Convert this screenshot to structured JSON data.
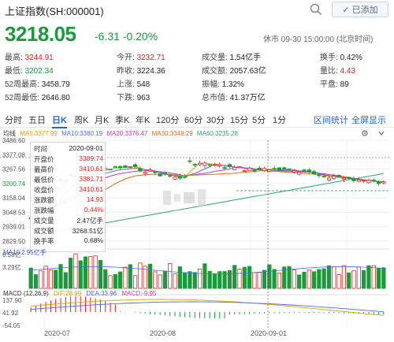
{
  "header": {
    "title": "上证指数(SH:000001)",
    "added_label": "已添加",
    "added_icon": "check-icon",
    "search_icon": "search-icon"
  },
  "quote": {
    "price": "3218.05",
    "change": "-6.31",
    "change_pct": "-0.20%",
    "status_time": "休市 09-30 15:00:00 (北京时间)"
  },
  "stats": {
    "high_label": "最高:",
    "high": "3244.91",
    "low_label": "最低:",
    "low": "3202.34",
    "wk52_high_label": "52周最高:",
    "wk52_high": "3458.79",
    "wk52_low_label": "52周最低:",
    "wk52_low": "2646.80",
    "open_label": "今开:",
    "open": "3232.71",
    "prev_close_label": "昨收:",
    "prev_close": "3224.36",
    "up_label": "上涨:",
    "up": "548",
    "down_label": "下跌:",
    "down": "963",
    "volume_label": "成交量:",
    "volume": "1.54亿手",
    "turnover_label": "成交额:",
    "turnover": "2057.63亿",
    "amplitude_label": "振幅:",
    "amplitude": "1.32%",
    "mktcap_label": "总市值:",
    "mktcap": "41.37万亿",
    "turnover_rate_label": "换手:",
    "turnover_rate": "0.42%",
    "vol_ratio_label": "量比:",
    "vol_ratio": "4.43",
    "flat_label": "平盘:",
    "flat": "89"
  },
  "tabs": [
    "分时",
    "五日",
    "日K",
    "周K",
    "月K",
    "季K",
    "年K",
    "120分",
    "60分",
    "30分",
    "15分",
    "5分",
    "1分"
  ],
  "active_tab": "日K",
  "tab_actions": {
    "interval_stats": "区间统计",
    "fullscreen": "全屏显示"
  },
  "ma_legend": {
    "ma_label": "均线",
    "ma5": "MA5:3377.99",
    "ma10": "MA10:3380.19",
    "ma20": "MA20:3376.47",
    "ma30": "MA30:3348.29",
    "ma60": "MA60:3235.28",
    "settings_icon": "gear-icon",
    "collapse_icon": "chevron-down-icon"
  },
  "colors": {
    "up": "#e02020",
    "down": "#1a9a3a",
    "ma5": "#d9a100",
    "ma10": "#4a6fd8",
    "ma20": "#c43bbd",
    "ma30": "#e06a1a",
    "ma60": "#2aa37a",
    "accent": "#2a64c5"
  },
  "price_axis": [
    "3486.60",
    "3377.08",
    "3267.56",
    "3200.74",
    "3158.04",
    "3048.53",
    "2939.01",
    "2829.50"
  ],
  "tooltip": {
    "rows": [
      {
        "label": "时间",
        "value": "2020-09-01"
      },
      {
        "label": "开盘价",
        "value": "3389.74"
      },
      {
        "label": "最高价",
        "value": "3410.61"
      },
      {
        "label": "最低价",
        "value": "3381.71"
      },
      {
        "label": "收盘价",
        "value": "3410.61"
      },
      {
        "label": "涨跌额",
        "value": "14.93"
      },
      {
        "label": "涨跌幅",
        "value": "0.44%"
      },
      {
        "label": "成交量",
        "value": "2.47亿手"
      },
      {
        "label": "成交额",
        "value": "3268.51亿"
      },
      {
        "label": "换手率",
        "value": "0.68%"
      }
    ]
  },
  "volume": {
    "legend": "MA10:2.95亿手",
    "axis": [
      "6.58亿",
      "3.29亿"
    ]
  },
  "macd": {
    "legend_label": "MACD (12,26,9)",
    "dif": "DIF:28.99",
    "dea": "DEA:33.96",
    "macd": "MACD:-9.95",
    "axis": [
      "137.90",
      "41.92",
      "-54.05"
    ]
  },
  "x_labels": [
    "2020-07",
    "2020-08",
    "2020-09-01"
  ]
}
